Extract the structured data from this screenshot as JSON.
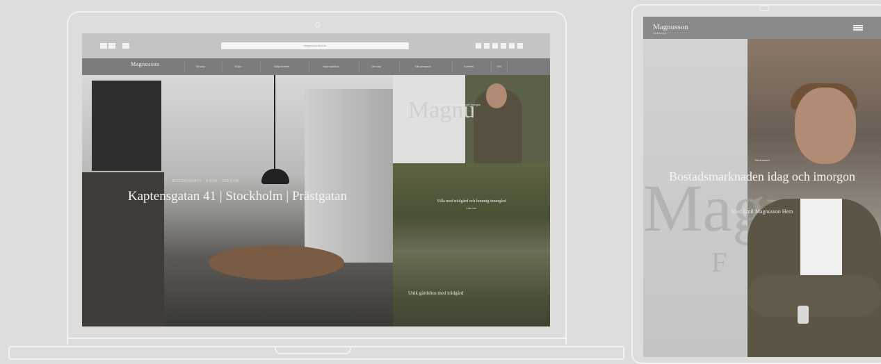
{
  "laptop": {
    "address": "magnussonfast.se",
    "site_logo": "Magnusson",
    "nav": [
      "Till salu",
      "Köpa",
      "Sälja bostad",
      "Nyproduktion",
      "Om oss",
      "Vår personal",
      "Kontakt",
      "EN"
    ],
    "hero": {
      "kicker": "BOSTADSRÄTT · 4 ROK · 168 KVM",
      "title": "Kapten­sgatan 41 | Stockholm | Prästgatan"
    },
    "tiles": [
      {
        "logo": "Magnusson",
        "caption": "Bostadsmarknaden idag och imorgon"
      },
      {
        "text": "Villa med trädgård och lummig innergård",
        "sub": "Läs mer"
      },
      {
        "text": "Unik gårdshus med trädgård"
      }
    ]
  },
  "tablet": {
    "logo": "Magnusson",
    "logo_sub": "Fastighetsbyrå",
    "big_text": "Magn",
    "big_text2": "F",
    "kicker": "Seminarium",
    "title": "Bostadsmarknaden idag och imorgon",
    "subtitle": "Med Emil Magnusson Hem"
  },
  "colors": {
    "background": "#dedddb",
    "device_outline": "#f3f2f0",
    "nav_bar": "#7c7c7c"
  }
}
